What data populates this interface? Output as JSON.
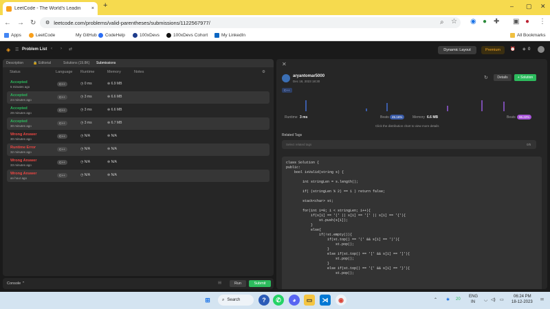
{
  "browser": {
    "tab_title": "LeetCode - The World's Leadin",
    "tab_close": "×",
    "new_tab": "+",
    "url": "leetcode.com/problems/valid-parentheses/submissions/1122567977/",
    "bookmarks": [
      "Apps",
      "LeetCode",
      "My GitHub",
      "CodeHelp",
      "100xDevs",
      "100xDevs Cohort",
      "My LinkedIn"
    ],
    "all_bookmarks": "All Bookmarks",
    "window_controls": [
      "–",
      "▢",
      "✕"
    ]
  },
  "lc_nav": {
    "problem_list": "Problem List",
    "dynamic_layout": "Dynamic Layout",
    "premium": "Premium",
    "streak": "0"
  },
  "left_tabs": [
    "Description",
    "Editorial",
    "Solutions (19.8K)",
    "Submissions"
  ],
  "columns": [
    "Status",
    "Language",
    "Runtime",
    "Memory",
    "Notes"
  ],
  "submissions": [
    {
      "status": "Accepted",
      "time": "5 minutes ago",
      "lang": "C++",
      "runtime": "0 ms",
      "memory": "6.9 MB",
      "kind": "ok"
    },
    {
      "status": "Accepted",
      "time": "24 minutes ago",
      "lang": "C++",
      "runtime": "3 ms",
      "memory": "6.6 MB",
      "kind": "ok"
    },
    {
      "status": "Accepted",
      "time": "29 minutes ago",
      "lang": "C++",
      "runtime": "3 ms",
      "memory": "6.6 MB",
      "kind": "ok"
    },
    {
      "status": "Accepted",
      "time": "30 minutes ago",
      "lang": "C++",
      "runtime": "3 ms",
      "memory": "6.7 MB",
      "kind": "ok"
    },
    {
      "status": "Wrong Answer",
      "time": "30 minutes ago",
      "lang": "C++",
      "runtime": "N/A",
      "memory": "N/A",
      "kind": "err"
    },
    {
      "status": "Runtime Error",
      "time": "32 minutes ago",
      "lang": "C++",
      "runtime": "N/A",
      "memory": "N/A",
      "kind": "err"
    },
    {
      "status": "Wrong Answer",
      "time": "33 minutes ago",
      "lang": "C++",
      "runtime": "N/A",
      "memory": "N/A",
      "kind": "err"
    },
    {
      "status": "Wrong Answer",
      "time": "an hour ago",
      "lang": "C++",
      "runtime": "N/A",
      "memory": "N/A",
      "kind": "err"
    }
  ],
  "console": {
    "label": "Console",
    "run": "Run",
    "submit": "Submit"
  },
  "detail": {
    "user": "aryantomar5000",
    "date": "Dec 18, 2023 18:30",
    "details_btn": "Details",
    "solution_btn": "+ Solution",
    "lang_badge": "C++",
    "runtime_label": "Runtime",
    "runtime_value": "3 ms",
    "beats_label": "Beats",
    "runtime_beats": "45.16%",
    "memory_label": "Memory",
    "memory_value": "6.6 MB",
    "memory_beats": "96.22%",
    "hint": "Click the distribution chart to view more details",
    "related_tags": "Related Tags",
    "tag_placeholder": "Select related tags",
    "tag_count": "0/5"
  },
  "code": [
    "class Solution {",
    "public:",
    "    bool isValid(string s) {",
    "",
    "        int stringLen = s.length();",
    "",
    "        if( (stringLen % 2) == 1 ) return false;",
    "",
    "        stack<char> st;",
    "",
    "        for(int i=0; i < stringLen; i++){",
    "            if(s[i] == '(' || s[i] == '[' || s[i] == '{'){",
    "                st.push(s[i]);",
    "            }",
    "            else{",
    "                if(!st.empty()){",
    "                    if(st.top() == '(' && s[i] == ')'){",
    "                        st.pop();",
    "                    }",
    "                    else if(st.top() == '[' && s[i] == ']'){",
    "                        st.pop();",
    "                    }",
    "                    else if(st.top() == '{' && s[i] == '}'){",
    "                        st.pop();",
    "                    }"
  ],
  "taskbar": {
    "search": "Search",
    "lang1": "ENG",
    "lang2": "IN",
    "time": "06:24 PM",
    "date": "18-12-2023",
    "temp": "20"
  }
}
